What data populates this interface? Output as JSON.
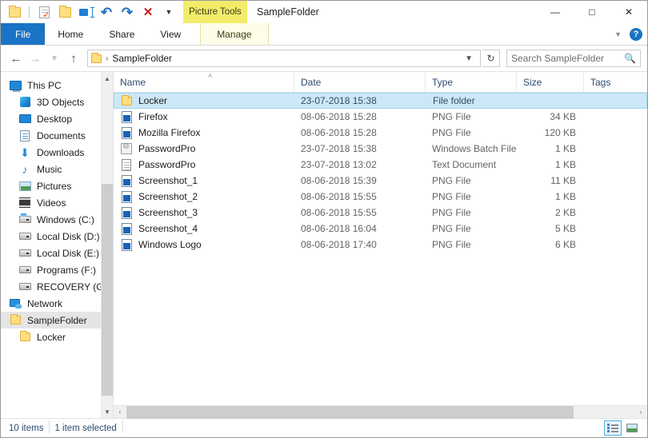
{
  "window": {
    "title": "SampleFolder",
    "contextual_tool": "Picture Tools",
    "minimize": "—",
    "maximize": "☐",
    "close": "✕",
    "collapse_ribbon": "˅",
    "help": "?"
  },
  "quick_access": [
    {
      "name": "folder-icon",
      "label": ""
    },
    {
      "name": "properties-icon",
      "label": ""
    },
    {
      "name": "new-folder-icon",
      "label": ""
    },
    {
      "name": "rename-icon",
      "label": ""
    },
    {
      "name": "undo-icon",
      "label": "↺"
    },
    {
      "name": "redo-icon",
      "label": "↻"
    },
    {
      "name": "delete-icon",
      "label": "✕"
    },
    {
      "name": "customize-chevron-icon",
      "label": "▾"
    }
  ],
  "tabs": [
    {
      "label": "File"
    },
    {
      "label": "Home"
    },
    {
      "label": "Share"
    },
    {
      "label": "View"
    },
    {
      "label": "Manage"
    }
  ],
  "address": {
    "back": "←",
    "forward": "→",
    "history": "˅",
    "up": "↑",
    "separator": "›",
    "crumb": "SampleFolder",
    "dropdown": "˅",
    "refresh": "↻"
  },
  "search": {
    "placeholder": "Search SampleFolder",
    "icon": "⌕"
  },
  "sidebar": {
    "scroll_up": "˄",
    "scroll_down": "˅",
    "items": [
      {
        "label": "This PC",
        "icon": "monitor-icon",
        "level": 0,
        "selected": false
      },
      {
        "label": "3D Objects",
        "icon": "cube-icon",
        "level": 1,
        "selected": false
      },
      {
        "label": "Desktop",
        "icon": "desktop-icon",
        "level": 1,
        "selected": false
      },
      {
        "label": "Documents",
        "icon": "document-icon",
        "level": 1,
        "selected": false
      },
      {
        "label": "Downloads",
        "icon": "download-icon",
        "level": 1,
        "selected": false
      },
      {
        "label": "Music",
        "icon": "music-icon",
        "level": 1,
        "selected": false
      },
      {
        "label": "Pictures",
        "icon": "picture-icon",
        "level": 1,
        "selected": false
      },
      {
        "label": "Videos",
        "icon": "video-icon",
        "level": 1,
        "selected": false
      },
      {
        "label": "Windows (C:)",
        "icon": "drive-windows-icon",
        "level": 1,
        "selected": false
      },
      {
        "label": "Local Disk (D:)",
        "icon": "drive-icon",
        "level": 1,
        "selected": false
      },
      {
        "label": "Local Disk (E:)",
        "icon": "drive-icon",
        "level": 1,
        "selected": false
      },
      {
        "label": "Programs (F:)",
        "icon": "drive-icon",
        "level": 1,
        "selected": false
      },
      {
        "label": "RECOVERY (G:)",
        "icon": "drive-icon",
        "level": 1,
        "selected": false
      },
      {
        "label": "Network",
        "icon": "network-icon",
        "level": 0,
        "selected": false
      },
      {
        "label": "SampleFolder",
        "icon": "folder-icon",
        "level": 0,
        "selected": true
      },
      {
        "label": "Locker",
        "icon": "folder-icon",
        "level": 1,
        "selected": false
      }
    ]
  },
  "columns": [
    {
      "label": "Name",
      "sorted": "asc",
      "caret": "˄"
    },
    {
      "label": "Date"
    },
    {
      "label": "Type"
    },
    {
      "label": "Size"
    },
    {
      "label": "Tags"
    }
  ],
  "files": [
    {
      "name": "Locker",
      "date": "23-07-2018 15:38",
      "type": "File folder",
      "size": "",
      "icon": "folder-icon",
      "selected": true
    },
    {
      "name": "Firefox",
      "date": "08-06-2018 15:28",
      "type": "PNG File",
      "size": "34 KB",
      "icon": "png-file-icon",
      "selected": false
    },
    {
      "name": "Mozilla Firefox",
      "date": "08-06-2018 15:28",
      "type": "PNG File",
      "size": "120 KB",
      "icon": "png-file-icon",
      "selected": false
    },
    {
      "name": "PasswordPro",
      "date": "23-07-2018 15:38",
      "type": "Windows Batch File",
      "size": "1 KB",
      "icon": "batch-file-icon",
      "selected": false
    },
    {
      "name": "PasswordPro",
      "date": "23-07-2018 13:02",
      "type": "Text Document",
      "size": "1 KB",
      "icon": "text-file-icon",
      "selected": false
    },
    {
      "name": "Screenshot_1",
      "date": "08-06-2018 15:39",
      "type": "PNG File",
      "size": "11 KB",
      "icon": "png-file-icon",
      "selected": false
    },
    {
      "name": "Screenshot_2",
      "date": "08-06-2018 15:55",
      "type": "PNG File",
      "size": "1 KB",
      "icon": "png-file-icon",
      "selected": false
    },
    {
      "name": "Screenshot_3",
      "date": "08-06-2018 15:55",
      "type": "PNG File",
      "size": "2 KB",
      "icon": "png-file-icon",
      "selected": false
    },
    {
      "name": "Screenshot_4",
      "date": "08-06-2018 16:04",
      "type": "PNG File",
      "size": "5 KB",
      "icon": "png-file-icon",
      "selected": false
    },
    {
      "name": "Windows Logo",
      "date": "08-06-2018 17:40",
      "type": "PNG File",
      "size": "6 KB",
      "icon": "png-file-icon",
      "selected": false
    }
  ],
  "hscroll": {
    "left": "‹",
    "right": "›"
  },
  "status": {
    "item_count": "10 items",
    "selection": "1 item selected"
  },
  "view_buttons": [
    {
      "name": "details-view-button",
      "active": true
    },
    {
      "name": "large-icons-view-button",
      "active": false
    }
  ],
  "colors": {
    "file_tab_blue": "#1a73c4",
    "contextual_yellow": "#f2ec6a",
    "selection_blue": "#cce8f7",
    "folder_yellow": "#ffdf7e",
    "status_text": "#2b4a6f"
  }
}
